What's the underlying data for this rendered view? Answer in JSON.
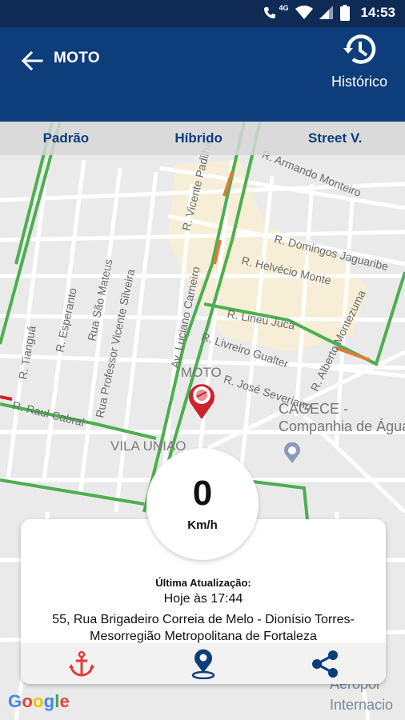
{
  "status_bar": {
    "time": "14:53",
    "network_label": "4G",
    "icons": [
      "call-icon",
      "wifi-icon",
      "signal-icon",
      "battery-icon"
    ]
  },
  "app_bar": {
    "title": "MOTO",
    "history_label": "Histórico",
    "background_color": "#0d3d7a"
  },
  "map_tabs": [
    "Padrão",
    "Híbrido",
    "Street V."
  ],
  "map": {
    "streets": [
      "R. Armando Monteiro",
      "R. Vicente Padilha",
      "R. Domingos Jaguaribe",
      "R. Helvécio Monte",
      "R. Lineu Jucá",
      "R. Livreiro Gualter",
      "R. Alberto Montezuma",
      "Av. Luciano Carneiro",
      "R. José Severiano",
      "R. Esperanto",
      "Rua São Mateus",
      "Rua Professor Vicente Silveira",
      "R. Tianguá",
      "R. Raul Cabral"
    ],
    "neighborhood": "VILA UNIAO",
    "poi": [
      "CAGECE -",
      "Companhia de Água"
    ],
    "airport": [
      "Aeropor",
      "Internacio"
    ],
    "vehicle_label": "MOTO",
    "google": [
      "G",
      "o",
      "o",
      "g",
      "l",
      "e"
    ]
  },
  "speed": {
    "value": "0",
    "unit": "Km/h"
  },
  "info": {
    "update_title": "Última Atualização:",
    "update_time": "Hoje às 17:44",
    "address": "55, Rua Brigadeiro Correia de Melo - Dionísio Torres-Mesorregião Metropolitana de Fortaleza"
  },
  "actions": [
    "anchor-icon",
    "location-pin-icon",
    "share-icon"
  ],
  "colors": {
    "accent": "#0d3d7a",
    "marker": "#d0202a",
    "traffic_green": "#4caf50",
    "traffic_orange": "#e07a3a"
  }
}
